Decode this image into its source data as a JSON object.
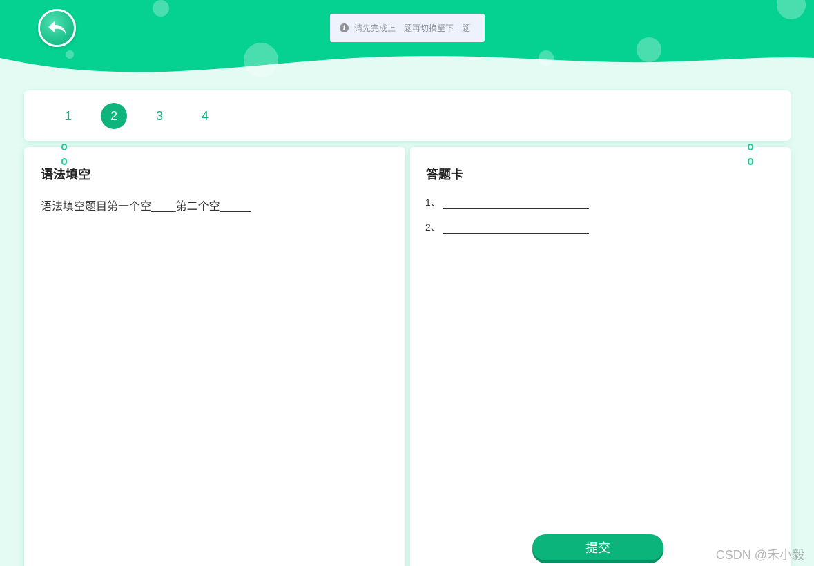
{
  "header": {
    "back_icon": "reply-arrow-icon",
    "toast": {
      "icon": "info-icon",
      "icon_glyph": "i",
      "message": "请先完成上一题再切换至下一题"
    }
  },
  "question_nav": {
    "items": [
      "1",
      "2",
      "3",
      "4"
    ],
    "active_index": 1,
    "accent_color": "#0fb47d"
  },
  "question_panel": {
    "title": "语法填空",
    "text_parts": [
      "语法填空题目第一个空",
      "____",
      "第二个空",
      "_____"
    ]
  },
  "answer_card": {
    "title": "答题卡",
    "rows": [
      {
        "label": "1、",
        "value": ""
      },
      {
        "label": "2、",
        "value": ""
      }
    ],
    "submit_label": "提交"
  },
  "watermark": "CSDN @禾小毅",
  "colors": {
    "header_green": "#05d190",
    "page_bg": "#e3fbf3",
    "button_green": "#0bb47a"
  }
}
